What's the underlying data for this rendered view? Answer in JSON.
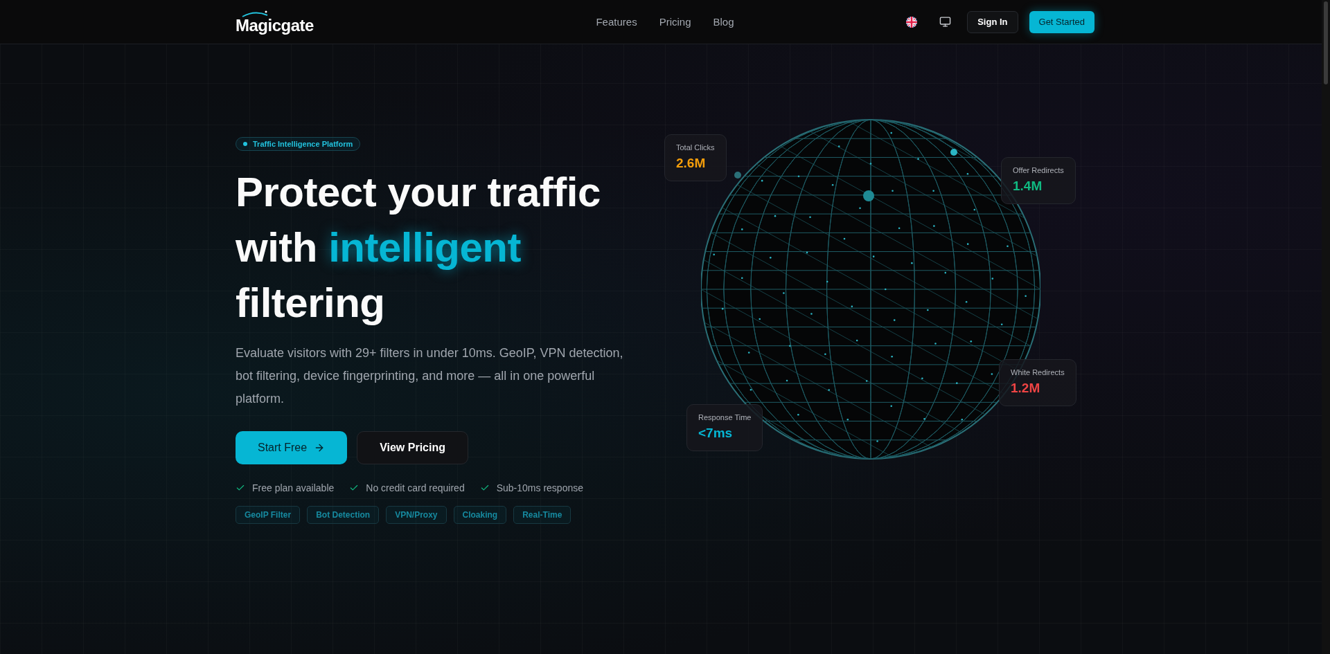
{
  "nav": {
    "logo": "Magicgate",
    "links": [
      {
        "label": "Features"
      },
      {
        "label": "Pricing"
      },
      {
        "label": "Blog"
      }
    ],
    "sign_in": "Sign In",
    "get_started": "Get Started"
  },
  "hero": {
    "badge": "Traffic Intelligence Platform",
    "title": [
      {
        "text": "Protect your traffic ",
        "highlight": false
      },
      {
        "text": "with ",
        "highlight": false
      },
      {
        "text": "intelligent",
        "highlight": true
      },
      {
        "text": " filtering",
        "highlight": false
      }
    ],
    "description": "Evaluate visitors with 29+ filters in under 10ms. GeoIP, VPN detection, bot filtering, device fingerprinting, and more — all in one powerful platform.",
    "primary_button": "Start Free",
    "secondary_button": "View Pricing",
    "checks": [
      "Free plan available",
      "No credit card required",
      "Sub-10ms response"
    ],
    "tags": [
      "GeoIP Filter",
      "Bot Detection",
      "VPN/Proxy",
      "Cloaking",
      "Real-Time"
    ]
  },
  "stats": [
    {
      "label": "Total Clicks",
      "value": "2.6M",
      "color": "#f59e0b"
    },
    {
      "label": "Offer Redirects",
      "value": "1.4M",
      "color": "#10b981"
    },
    {
      "label": "White Redirects",
      "value": "1.2M",
      "color": "#ef4444"
    },
    {
      "label": "Response Time",
      "value": "<7ms",
      "color": "#06b6d4"
    }
  ]
}
